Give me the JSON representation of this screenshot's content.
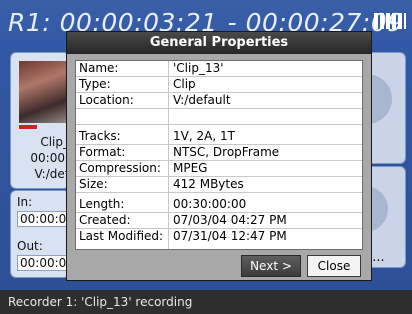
{
  "header": {
    "recorder_timecode": "R1: 00:00:03:21",
    "remaining_timecode": "- 00:00:27:09",
    "level_icon": "level-meter-icon"
  },
  "clip_card": {
    "name": "Clip_",
    "timecode": "00:00:",
    "location": "V:/def"
  },
  "inout": {
    "in_label": "In:",
    "in_value": "00:00:0",
    "out_label": "Out:",
    "out_value": "00:00:0"
  },
  "right_panel": {
    "ellipsis": "p..."
  },
  "dialog": {
    "title": "General Properties",
    "properties": [
      {
        "key": "Name:",
        "value": "'Clip_13'"
      },
      {
        "key": "Type:",
        "value": "Clip"
      },
      {
        "key": "Location:",
        "value": "V:/default"
      },
      {
        "key": "",
        "value": ""
      },
      {
        "key": "Tracks:",
        "value": "1V, 2A, 1T"
      },
      {
        "key": "Format:",
        "value": "NTSC, DropFrame"
      },
      {
        "key": "Compression:",
        "value": "MPEG"
      },
      {
        "key": "Size:",
        "value": "412 MBytes"
      },
      {
        "key": "Length:",
        "value": "00:30:00:00"
      },
      {
        "key": "Created:",
        "value": "07/03/04 04:27 PM"
      },
      {
        "key": "Last Modified:",
        "value": "07/31/04 12:47 PM"
      }
    ],
    "next_label": "Next >",
    "close_label": "Close"
  },
  "status": {
    "text": "Recorder 1: 'Clip_13' recording"
  }
}
